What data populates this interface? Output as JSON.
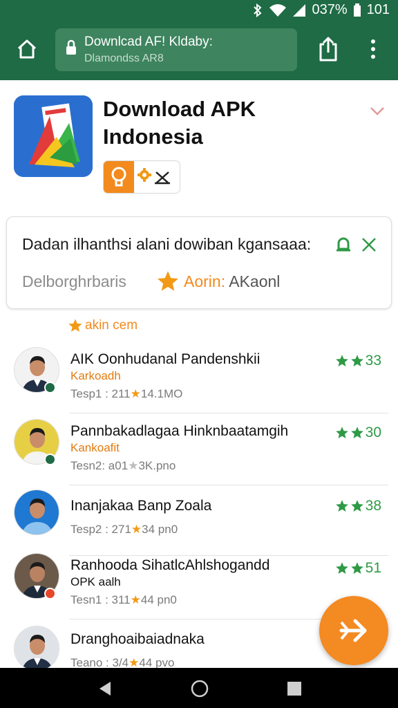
{
  "status_bar": {
    "battery_percent": "037%",
    "time": "101"
  },
  "browser": {
    "url_title": "Downlcad AF! Kldaby:",
    "url_subtitle": "Dlamondss AR8",
    "icons": {
      "home": "home-icon",
      "lock": "lock-icon",
      "share": "share-icon",
      "menu": "more-vert-icon"
    }
  },
  "app": {
    "title": "Download APK Indonesia",
    "icon": "apk-app-icon",
    "pill_icons": [
      "lightbulb-icon",
      "gear-icon",
      "x-tool-icon"
    ]
  },
  "info_card": {
    "text": "Dadan ilhanthsi alani dowiban kgansaaa:",
    "subtext": "Delborghrbaris",
    "rating_label": "Aorin:",
    "rating_value": "AKaonl"
  },
  "section": {
    "label": "akin cem"
  },
  "list": [
    {
      "title": "AIK Oonhudanal Pandenshkii",
      "subtitle": "Karkoadh",
      "meta_prefix": "Tesp1 : 211",
      "meta_star": "★",
      "meta_suffix": "14.1MO",
      "rating": "33",
      "badge_color": "#1e6b45"
    },
    {
      "title": "Pannbakadlagaa Hinknbaatamgih",
      "subtitle": "Kankoafit",
      "meta_prefix": "Tesn2: a01",
      "meta_star": "★",
      "meta_suffix": "3K.pno",
      "rating": "30",
      "badge_color": "#1e6b45"
    },
    {
      "title": "Inanjakaa Banp Zoala",
      "subtitle": "",
      "meta_prefix": "Tesp2 : 271",
      "meta_star": "★",
      "meta_suffix": "34 pn0",
      "rating": "38",
      "badge_color": ""
    },
    {
      "title": "Ranhooda SihatlсAhlshogandd",
      "subtitle": "OPK aalh",
      "meta_prefix": "Tesn1 : 311",
      "meta_star": "★",
      "meta_suffix": "44 pn0",
      "rating": "51",
      "badge_color": "#e8462a"
    },
    {
      "title": "Dranghoaibaiadnaka",
      "subtitle": "",
      "meta_prefix": "Teano : 3/4",
      "meta_star": "★",
      "meta_suffix": "44 pvo",
      "rating": "",
      "badge_color": ""
    }
  ],
  "colors": {
    "primary": "#1e6b45",
    "accent": "#f28a1d",
    "rating_green": "#2e9a45"
  },
  "fab": {
    "icon": "send-arrow-icon"
  },
  "nav": {
    "back": "back-triangle-icon",
    "home": "home-circle-icon",
    "recent": "recent-square-icon"
  }
}
